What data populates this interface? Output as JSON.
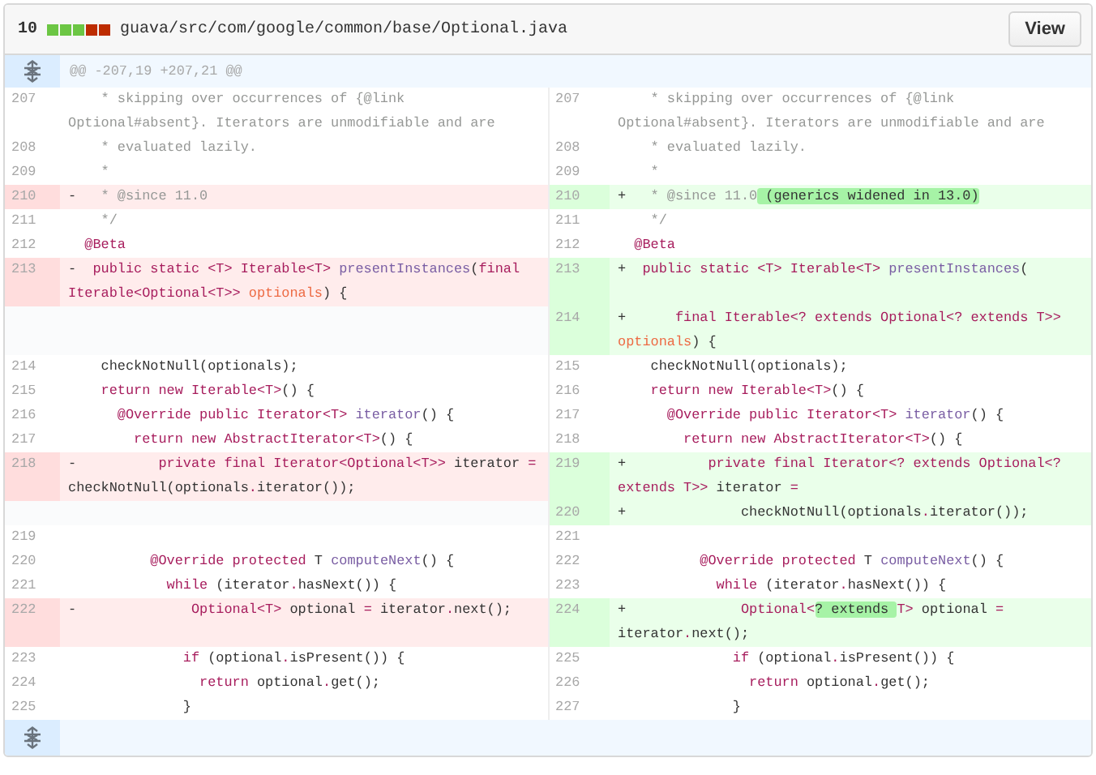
{
  "file": {
    "changes": "10",
    "diffstat": [
      {
        "color": "#6cc644"
      },
      {
        "color": "#6cc644"
      },
      {
        "color": "#6cc644"
      },
      {
        "color": "#bd2c00"
      },
      {
        "color": "#bd2c00"
      }
    ],
    "path": "guava/src/com/google/common/base/Optional.java",
    "view_button": "View"
  },
  "hunk_header": "@@ -207,19 +207,21 @@",
  "rows": [
    {
      "left": {
        "kind": "context",
        "num": "207",
        "code": [
          {
            "t": "    * skipping over occurrences of {@link Optional#absent}. Iterators are unmodifiable and are",
            "kind": "comment"
          }
        ]
      },
      "right": {
        "kind": "context",
        "num": "207",
        "code": [
          {
            "t": "    * skipping over occurrences of {@link Optional#absent}. Iterators are unmodifiable and are",
            "kind": "comment"
          }
        ]
      }
    },
    {
      "left": {
        "kind": "context",
        "num": "208",
        "code": [
          {
            "t": "    * evaluated lazily.",
            "kind": "comment"
          }
        ]
      },
      "right": {
        "kind": "context",
        "num": "208",
        "code": [
          {
            "t": "    * evaluated lazily.",
            "kind": "comment"
          }
        ]
      }
    },
    {
      "left": {
        "kind": "context",
        "num": "209",
        "code": [
          {
            "t": "    *",
            "kind": "comment"
          }
        ]
      },
      "right": {
        "kind": "context",
        "num": "209",
        "code": [
          {
            "t": "    *",
            "kind": "comment"
          }
        ]
      }
    },
    {
      "left": {
        "kind": "deletion",
        "num": "210",
        "marker": "-",
        "code": [
          {
            "t": "   * @since 11.0",
            "kind": "comment"
          }
        ]
      },
      "right": {
        "kind": "addition",
        "num": "210",
        "marker": "+",
        "code": [
          {
            "t": "   * @since 11.0",
            "kind": "comment"
          },
          {
            "t": " (generics widened in 13.0)",
            "kind": "highlight"
          }
        ]
      }
    },
    {
      "left": {
        "kind": "context",
        "num": "211",
        "code": [
          {
            "t": "    */",
            "kind": "comment"
          }
        ]
      },
      "right": {
        "kind": "context",
        "num": "211",
        "code": [
          {
            "t": "    */",
            "kind": "comment"
          }
        ]
      }
    },
    {
      "left": {
        "kind": "context",
        "num": "212",
        "code": [
          {
            "t": "  @Beta",
            "kind": "keyword"
          }
        ]
      },
      "right": {
        "kind": "context",
        "num": "212",
        "code": [
          {
            "t": "  @Beta",
            "kind": "keyword"
          }
        ]
      }
    },
    {
      "left": {
        "kind": "deletion",
        "num": "213",
        "marker": "-",
        "code": [
          {
            "t": "  public static <T> Iterable<T> ",
            "kind": "keyword"
          },
          {
            "t": "presentInstances",
            "kind": "entity"
          },
          {
            "t": "(",
            "kind": "plain"
          },
          {
            "t": "final Iterable<Optional<T>> ",
            "kind": "keyword"
          },
          {
            "t": "optionals",
            "kind": "variable"
          },
          {
            "t": ") {",
            "kind": "plain"
          }
        ]
      },
      "right": {
        "kind": "addition",
        "num": "213",
        "marker": "+",
        "code": [
          {
            "t": "  public static <T> Iterable<T> ",
            "kind": "keyword"
          },
          {
            "t": "presentInstances",
            "kind": "entity"
          },
          {
            "t": "(",
            "kind": "plain"
          }
        ]
      }
    },
    {
      "left": {
        "kind": "empty"
      },
      "right": {
        "kind": "addition",
        "num": "214",
        "marker": "+",
        "code": [
          {
            "t": "      final Iterable<? extends Optional<? extends T>> ",
            "kind": "keyword"
          },
          {
            "t": "optionals",
            "kind": "variable"
          },
          {
            "t": ") {",
            "kind": "plain"
          }
        ]
      }
    },
    {
      "left": {
        "kind": "context",
        "num": "214",
        "code": [
          {
            "t": "    checkNotNull(optionals);",
            "kind": "plain"
          }
        ]
      },
      "right": {
        "kind": "context",
        "num": "215",
        "code": [
          {
            "t": "    checkNotNull(optionals);",
            "kind": "plain"
          }
        ]
      }
    },
    {
      "left": {
        "kind": "context",
        "num": "215",
        "code": [
          {
            "t": "    return new Iterable<T>",
            "kind": "keyword"
          },
          {
            "t": "() {",
            "kind": "plain"
          }
        ]
      },
      "right": {
        "kind": "context",
        "num": "216",
        "code": [
          {
            "t": "    return new Iterable<T>",
            "kind": "keyword"
          },
          {
            "t": "() {",
            "kind": "plain"
          }
        ]
      }
    },
    {
      "left": {
        "kind": "context",
        "num": "216",
        "code": [
          {
            "t": "      @Override public Iterator<T> ",
            "kind": "keyword"
          },
          {
            "t": "iterator",
            "kind": "entity"
          },
          {
            "t": "() {",
            "kind": "plain"
          }
        ]
      },
      "right": {
        "kind": "context",
        "num": "217",
        "code": [
          {
            "t": "      @Override public Iterator<T> ",
            "kind": "keyword"
          },
          {
            "t": "iterator",
            "kind": "entity"
          },
          {
            "t": "() {",
            "kind": "plain"
          }
        ]
      }
    },
    {
      "left": {
        "kind": "context",
        "num": "217",
        "code": [
          {
            "t": "        return new AbstractIterator<T>",
            "kind": "keyword"
          },
          {
            "t": "() {",
            "kind": "plain"
          }
        ]
      },
      "right": {
        "kind": "context",
        "num": "218",
        "code": [
          {
            "t": "        return new AbstractIterator<T>",
            "kind": "keyword"
          },
          {
            "t": "() {",
            "kind": "plain"
          }
        ]
      }
    },
    {
      "left": {
        "kind": "deletion",
        "num": "218",
        "marker": "-",
        "code": [
          {
            "t": "          private final Iterator<Optional<T>>",
            "kind": "keyword"
          },
          {
            "t": " iterator ",
            "kind": "plain"
          },
          {
            "t": "=",
            "kind": "keyword"
          },
          {
            "t": " checkNotNull(optionals",
            "kind": "plain"
          },
          {
            "t": ".",
            "kind": "keyword"
          },
          {
            "t": "iterator());",
            "kind": "plain"
          }
        ]
      },
      "right": {
        "kind": "addition",
        "num": "219",
        "marker": "+",
        "code": [
          {
            "t": "          private final Iterator<? extends Optional<? extends T>>",
            "kind": "keyword"
          },
          {
            "t": " iterator ",
            "kind": "plain"
          },
          {
            "t": "=",
            "kind": "keyword"
          }
        ]
      }
    },
    {
      "left": {
        "kind": "empty"
      },
      "right": {
        "kind": "addition",
        "num": "220",
        "marker": "+",
        "code": [
          {
            "t": "              checkNotNull(optionals",
            "kind": "plain"
          },
          {
            "t": ".",
            "kind": "keyword"
          },
          {
            "t": "iterator());",
            "kind": "plain"
          }
        ]
      }
    },
    {
      "left": {
        "kind": "context",
        "num": "219"
      },
      "right": {
        "kind": "context",
        "num": "221"
      }
    },
    {
      "left": {
        "kind": "context",
        "num": "220",
        "code": [
          {
            "t": "          @Override protected",
            "kind": "keyword"
          },
          {
            "t": " T ",
            "kind": "plain"
          },
          {
            "t": "computeNext",
            "kind": "entity"
          },
          {
            "t": "() {",
            "kind": "plain"
          }
        ]
      },
      "right": {
        "kind": "context",
        "num": "222",
        "code": [
          {
            "t": "          @Override protected",
            "kind": "keyword"
          },
          {
            "t": " T ",
            "kind": "plain"
          },
          {
            "t": "computeNext",
            "kind": "entity"
          },
          {
            "t": "() {",
            "kind": "plain"
          }
        ]
      }
    },
    {
      "left": {
        "kind": "context",
        "num": "221",
        "code": [
          {
            "t": "            while",
            "kind": "keyword"
          },
          {
            "t": " (iterator",
            "kind": "plain"
          },
          {
            "t": ".",
            "kind": "keyword"
          },
          {
            "t": "hasNext()) {",
            "kind": "plain"
          }
        ]
      },
      "right": {
        "kind": "context",
        "num": "223",
        "code": [
          {
            "t": "            while",
            "kind": "keyword"
          },
          {
            "t": " (iterator",
            "kind": "plain"
          },
          {
            "t": ".",
            "kind": "keyword"
          },
          {
            "t": "hasNext()) {",
            "kind": "plain"
          }
        ]
      }
    },
    {
      "left": {
        "kind": "deletion",
        "num": "222",
        "marker": "-",
        "code": [
          {
            "t": "              Optional<T>",
            "kind": "keyword"
          },
          {
            "t": " optional ",
            "kind": "plain"
          },
          {
            "t": "=",
            "kind": "keyword"
          },
          {
            "t": " iterator",
            "kind": "plain"
          },
          {
            "t": ".",
            "kind": "keyword"
          },
          {
            "t": "next();",
            "kind": "plain"
          }
        ]
      },
      "right": {
        "kind": "addition",
        "num": "224",
        "marker": "+",
        "code": [
          {
            "t": "              Optional<",
            "kind": "keyword"
          },
          {
            "t": "? extends ",
            "kind": "highlight"
          },
          {
            "t": "T>",
            "kind": "keyword"
          },
          {
            "t": " optional ",
            "kind": "plain"
          },
          {
            "t": "=",
            "kind": "keyword"
          },
          {
            "t": " iterator",
            "kind": "plain"
          },
          {
            "t": ".",
            "kind": "keyword"
          },
          {
            "t": "next();",
            "kind": "plain"
          }
        ]
      }
    },
    {
      "left": {
        "kind": "context",
        "num": "223",
        "code": [
          {
            "t": "              if",
            "kind": "keyword"
          },
          {
            "t": " (optional",
            "kind": "plain"
          },
          {
            "t": ".",
            "kind": "keyword"
          },
          {
            "t": "isPresent()) {",
            "kind": "plain"
          }
        ]
      },
      "right": {
        "kind": "context",
        "num": "225",
        "code": [
          {
            "t": "              if",
            "kind": "keyword"
          },
          {
            "t": " (optional",
            "kind": "plain"
          },
          {
            "t": ".",
            "kind": "keyword"
          },
          {
            "t": "isPresent()) {",
            "kind": "plain"
          }
        ]
      }
    },
    {
      "left": {
        "kind": "context",
        "num": "224",
        "code": [
          {
            "t": "                return",
            "kind": "keyword"
          },
          {
            "t": " optional",
            "kind": "plain"
          },
          {
            "t": ".",
            "kind": "keyword"
          },
          {
            "t": "get();",
            "kind": "plain"
          }
        ]
      },
      "right": {
        "kind": "context",
        "num": "226",
        "code": [
          {
            "t": "                return",
            "kind": "keyword"
          },
          {
            "t": " optional",
            "kind": "plain"
          },
          {
            "t": ".",
            "kind": "keyword"
          },
          {
            "t": "get();",
            "kind": "plain"
          }
        ]
      }
    },
    {
      "left": {
        "kind": "context",
        "num": "225",
        "code": [
          {
            "t": "              }",
            "kind": "plain"
          }
        ]
      },
      "right": {
        "kind": "context",
        "num": "227",
        "code": [
          {
            "t": "              }",
            "kind": "plain"
          }
        ]
      }
    }
  ]
}
